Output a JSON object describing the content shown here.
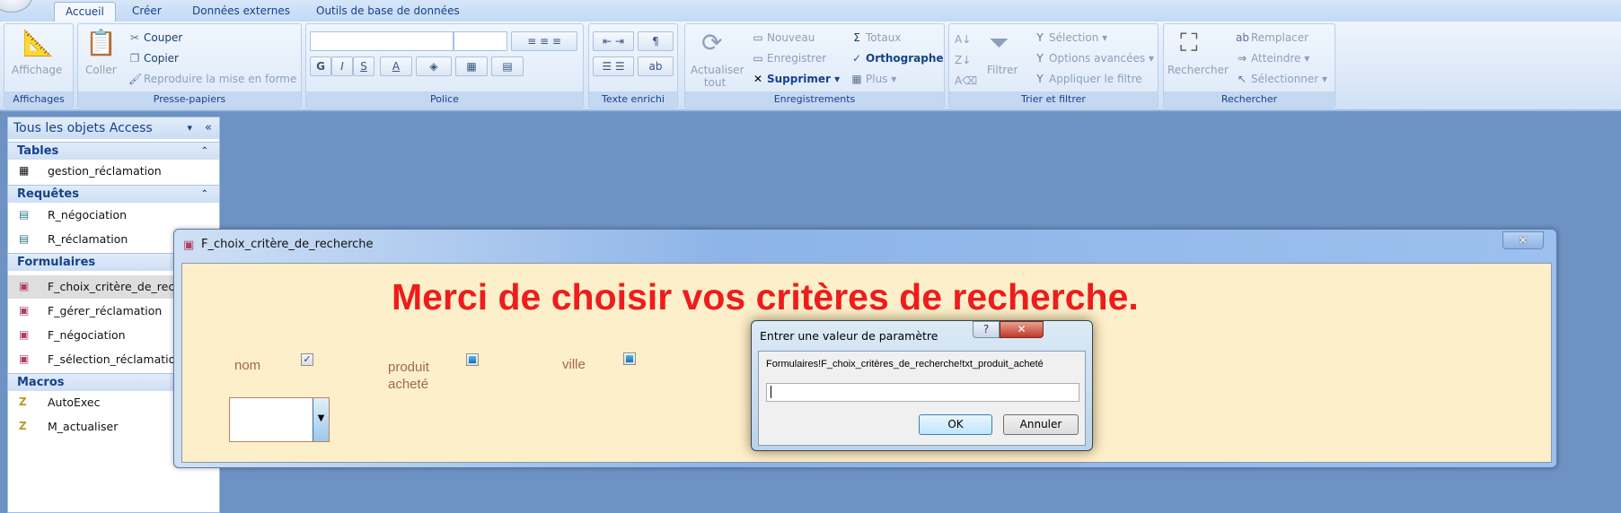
{
  "ribbon": {
    "tabs": [
      {
        "label": "Accueil",
        "active": true
      },
      {
        "label": "Créer"
      },
      {
        "label": "Données externes"
      },
      {
        "label": "Outils de base de données"
      }
    ],
    "groups": {
      "affichages": {
        "label": "Affichages",
        "affichage": "Affichage"
      },
      "presse": {
        "label": "Presse-papiers",
        "coller": "Coller",
        "couper": "Couper",
        "copier": "Copier",
        "reproduire": "Reproduire la mise en forme"
      },
      "police": {
        "label": "Police",
        "gras": "G",
        "italique": "I",
        "souligne": "S",
        "couleur": "A"
      },
      "texte": {
        "label": "Texte enrichi"
      },
      "enreg": {
        "label": "Enregistrements",
        "actualiser": "Actualiser",
        "tout": "tout",
        "nouveau": "Nouveau",
        "enregistrer": "Enregistrer",
        "supprimer": "Supprimer",
        "totaux": "Totaux",
        "orthographe": "Orthographe",
        "plus": "Plus"
      },
      "trier": {
        "label": "Trier et filtrer",
        "filtrer": "Filtrer",
        "selection": "Sélection",
        "options": "Options avancées",
        "appliquer": "Appliquer le filtre"
      },
      "rechercher": {
        "label": "Rechercher",
        "rechercher": "Rechercher",
        "remplacer": "Remplacer",
        "atteindre": "Atteindre",
        "selectionner": "Sélectionner"
      }
    }
  },
  "nav": {
    "title": "Tous les objets Access",
    "sections": [
      {
        "label": "Tables",
        "items": [
          "gestion_réclamation"
        ]
      },
      {
        "label": "Requêtes",
        "items": [
          "R_négociation",
          "R_réclamation"
        ]
      },
      {
        "label": "Formulaires",
        "items": [
          "F_choix_critère_de_recherche",
          "F_gérer_réclamation",
          "F_négociation",
          "F_sélection_réclamation"
        ],
        "selected": 0
      },
      {
        "label": "Macros",
        "items": [
          "AutoExec",
          "M_actualiser"
        ]
      }
    ]
  },
  "form": {
    "title": "F_choix_critère_de_recherche",
    "heading": "Merci de choisir vos critères de recherche.",
    "heading_color": "#ee1c1c",
    "fields": [
      {
        "label": "nom",
        "checked": true
      },
      {
        "label": "produit acheté",
        "checked": false
      },
      {
        "label": "ville",
        "checked": false
      }
    ],
    "combo_value": ""
  },
  "dialog": {
    "title": "Entrer une valeur de paramètre",
    "prompt": "Formulaires!F_choix_critères_de_recherche!txt_produit_acheté",
    "value": "",
    "ok": "OK",
    "cancel": "Annuler"
  }
}
